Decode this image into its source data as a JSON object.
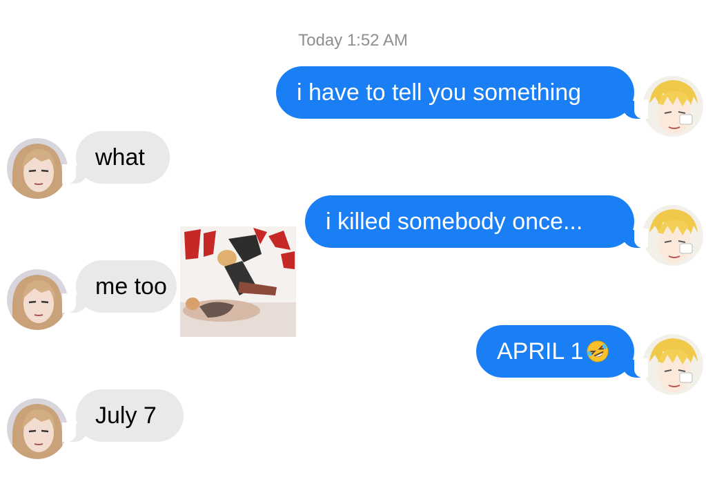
{
  "conversation": {
    "timestamp": "Today 1:52 AM",
    "messages": [
      {
        "from": "me",
        "text": "i have to tell you something"
      },
      {
        "from": "them",
        "text": "what"
      },
      {
        "from": "me",
        "text": "i killed somebody once..."
      },
      {
        "from": "them",
        "text": "me too"
      },
      {
        "from": "me",
        "text": "APRIL 1"
      },
      {
        "from": "them",
        "text": "July 7"
      }
    ],
    "emoji": "rolling-on-floor-laughing-emoji",
    "sticker": "manga-panel-image"
  },
  "colors": {
    "outgoing_bubble": "#1a7ef5",
    "incoming_bubble": "#e9e9eb",
    "timestamp": "#8e8e93"
  }
}
